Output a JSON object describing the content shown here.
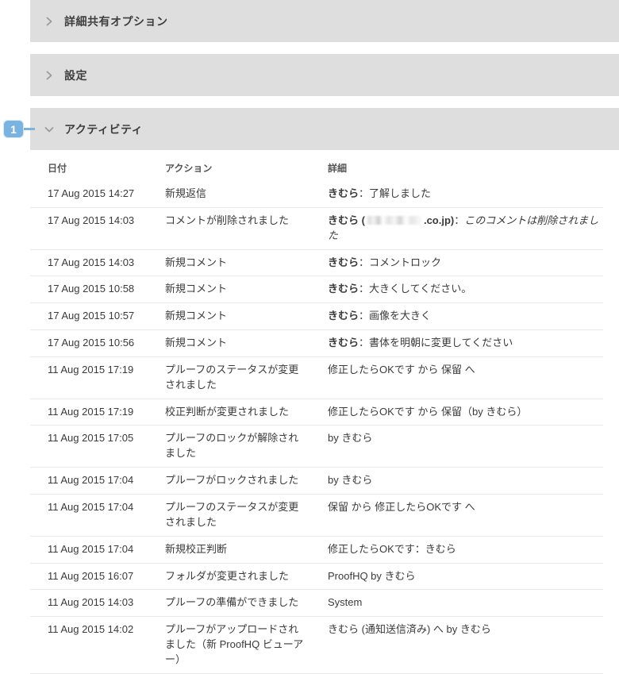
{
  "sections": [
    {
      "id": "advanced-sharing",
      "title": "詳細共有オプション",
      "expanded": false,
      "chevron": "chevron-right-icon"
    },
    {
      "id": "settings",
      "title": "設定",
      "expanded": false,
      "chevron": "chevron-right-icon"
    },
    {
      "id": "activity",
      "title": "アクティビティ",
      "expanded": true,
      "chevron": "chevron-down-icon"
    }
  ],
  "annotation": {
    "badge_label": "1",
    "badge_color": "#7ab2e0",
    "target_section": "activity"
  },
  "activity": {
    "columns": [
      "日付",
      "アクション",
      "詳細"
    ],
    "rows": [
      {
        "date": "17 Aug 2015 14:27",
        "action": "新規返信",
        "detail_user": "きむら",
        "detail_sep": "：",
        "detail_text": "了解しました",
        "redacted": false,
        "detail_italic": false
      },
      {
        "date": "17 Aug 2015 14:03",
        "action": "コメントが削除されました",
        "detail_user": "きむら (",
        "detail_user_tail": ".co.jp)",
        "detail_sep": "：",
        "detail_text": "このコメントは削除されました",
        "redacted": true,
        "detail_italic": true
      },
      {
        "date": "17 Aug 2015 14:03",
        "action": "新規コメント",
        "detail_user": "きむら",
        "detail_sep": "：",
        "detail_text": "コメントロック",
        "redacted": false,
        "detail_italic": false
      },
      {
        "date": "17 Aug 2015 10:58",
        "action": "新規コメント",
        "detail_user": "きむら",
        "detail_sep": "：",
        "detail_text": "大きくしてください。",
        "redacted": false,
        "detail_italic": false
      },
      {
        "date": "17 Aug 2015 10:57",
        "action": "新規コメント",
        "detail_user": "きむら",
        "detail_sep": "：",
        "detail_text": "画像を大きく",
        "redacted": false,
        "detail_italic": false
      },
      {
        "date": "17 Aug 2015 10:56",
        "action": "新規コメント",
        "detail_user": "きむら",
        "detail_sep": "：",
        "detail_text": "書体を明朝に変更してください",
        "redacted": false,
        "detail_italic": false
      },
      {
        "date": "11 Aug 2015 17:19",
        "action": "プルーフのステータスが変更されました",
        "detail_user": "",
        "detail_sep": "",
        "detail_text": "修正したらOKです から 保留 へ",
        "redacted": false,
        "detail_italic": false
      },
      {
        "date": "11 Aug 2015 17:19",
        "action": "校正判断が変更されました",
        "detail_user": "",
        "detail_sep": "",
        "detail_text": "修正したらOKです から 保留（by きむら）",
        "redacted": false,
        "detail_italic": false
      },
      {
        "date": "11 Aug 2015 17:05",
        "action": "プルーフのロックが解除されました",
        "detail_user": "",
        "detail_sep": "",
        "detail_text": "by きむら",
        "redacted": false,
        "detail_italic": false
      },
      {
        "date": "11 Aug 2015 17:04",
        "action": "プルーフがロックされました",
        "detail_user": "",
        "detail_sep": "",
        "detail_text": "by きむら",
        "redacted": false,
        "detail_italic": false
      },
      {
        "date": "11 Aug 2015 17:04",
        "action": "プルーフのステータスが変更されました",
        "detail_user": "",
        "detail_sep": "",
        "detail_text": "保留 から 修正したらOKです へ",
        "redacted": false,
        "detail_italic": false
      },
      {
        "date": "11 Aug 2015 17:04",
        "action": "新規校正判断",
        "detail_user": "",
        "detail_sep": "",
        "detail_text": "修正したらOKです：きむら",
        "redacted": false,
        "detail_italic": false
      },
      {
        "date": "11 Aug 2015 16:07",
        "action": "フォルダが変更されました",
        "detail_user": "",
        "detail_sep": "",
        "detail_text": "ProofHQ by きむら",
        "redacted": false,
        "detail_italic": false
      },
      {
        "date": "11 Aug 2015 14:03",
        "action": "プルーフの準備ができました",
        "detail_user": "",
        "detail_sep": "",
        "detail_text": "System",
        "redacted": false,
        "detail_italic": false
      },
      {
        "date": "11 Aug 2015 14:02",
        "action": "プルーフがアップロードされました（新 ProofHQ ビューアー）",
        "detail_user": "",
        "detail_sep": "",
        "detail_text": "きむら (通知送信済み) へ by きむら",
        "redacted": false,
        "detail_italic": false
      }
    ]
  }
}
